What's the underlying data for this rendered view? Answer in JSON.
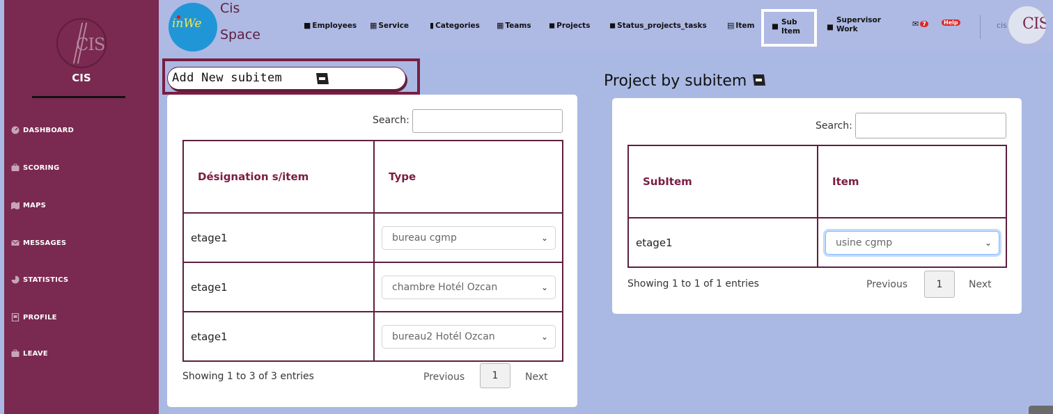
{
  "sidebar": {
    "title": "CIS",
    "items": [
      {
        "label": "DASHBOARD",
        "icon": "dashboard-icon"
      },
      {
        "label": "SCORING",
        "icon": "briefcase-icon"
      },
      {
        "label": "MAPS",
        "icon": "map-icon"
      },
      {
        "label": "MESSAGES",
        "icon": "envelope-icon"
      },
      {
        "label": "STATISTICS",
        "icon": "chart-icon"
      },
      {
        "label": "PROFILE",
        "icon": "id-card-icon"
      },
      {
        "label": "LEAVE",
        "icon": "briefcase-icon"
      }
    ]
  },
  "brand": {
    "logo_text": "inWe",
    "line1": "Cis",
    "line2": "Space"
  },
  "topnav": {
    "employees": "Employees",
    "service": "Service",
    "categories": "Categories",
    "teams": "Teams",
    "projects": "Projects",
    "status": "Status_projects_tasks",
    "item": "Item",
    "sub_item_line1": "Sub",
    "sub_item_line2": "Item",
    "supervisor_line1": "Supervisor",
    "supervisor_line2": "Work",
    "mail_count": "7",
    "help": "Help",
    "user": "cis"
  },
  "left": {
    "add_label": "Add New subitem",
    "search_label": "Search:",
    "columns": [
      "Désignation s/item",
      "Type"
    ],
    "rows": [
      {
        "designation": "etage1",
        "type": "bureau cgmp"
      },
      {
        "designation": "etage1",
        "type": "chambre Hotél Ozcan"
      },
      {
        "designation": "etage1",
        "type": "bureau2 Hotél Ozcan"
      }
    ],
    "info": "Showing 1 to 3 of 3 entries",
    "prev": "Previous",
    "page": "1",
    "next": "Next"
  },
  "right": {
    "title": "Project by subitem",
    "search_label": "Search:",
    "columns": [
      "SubItem",
      "Item"
    ],
    "rows": [
      {
        "subitem": "etage1",
        "item": "usine cgmp"
      }
    ],
    "info": "Showing 1 to 1 of 1 entries",
    "prev": "Previous",
    "page": "1",
    "next": "Next"
  },
  "colors": {
    "sidebar": "#7a2950",
    "background": "#a9b9e3",
    "accent": "#7a1d42",
    "brand_blue": "#1d9bd4"
  }
}
